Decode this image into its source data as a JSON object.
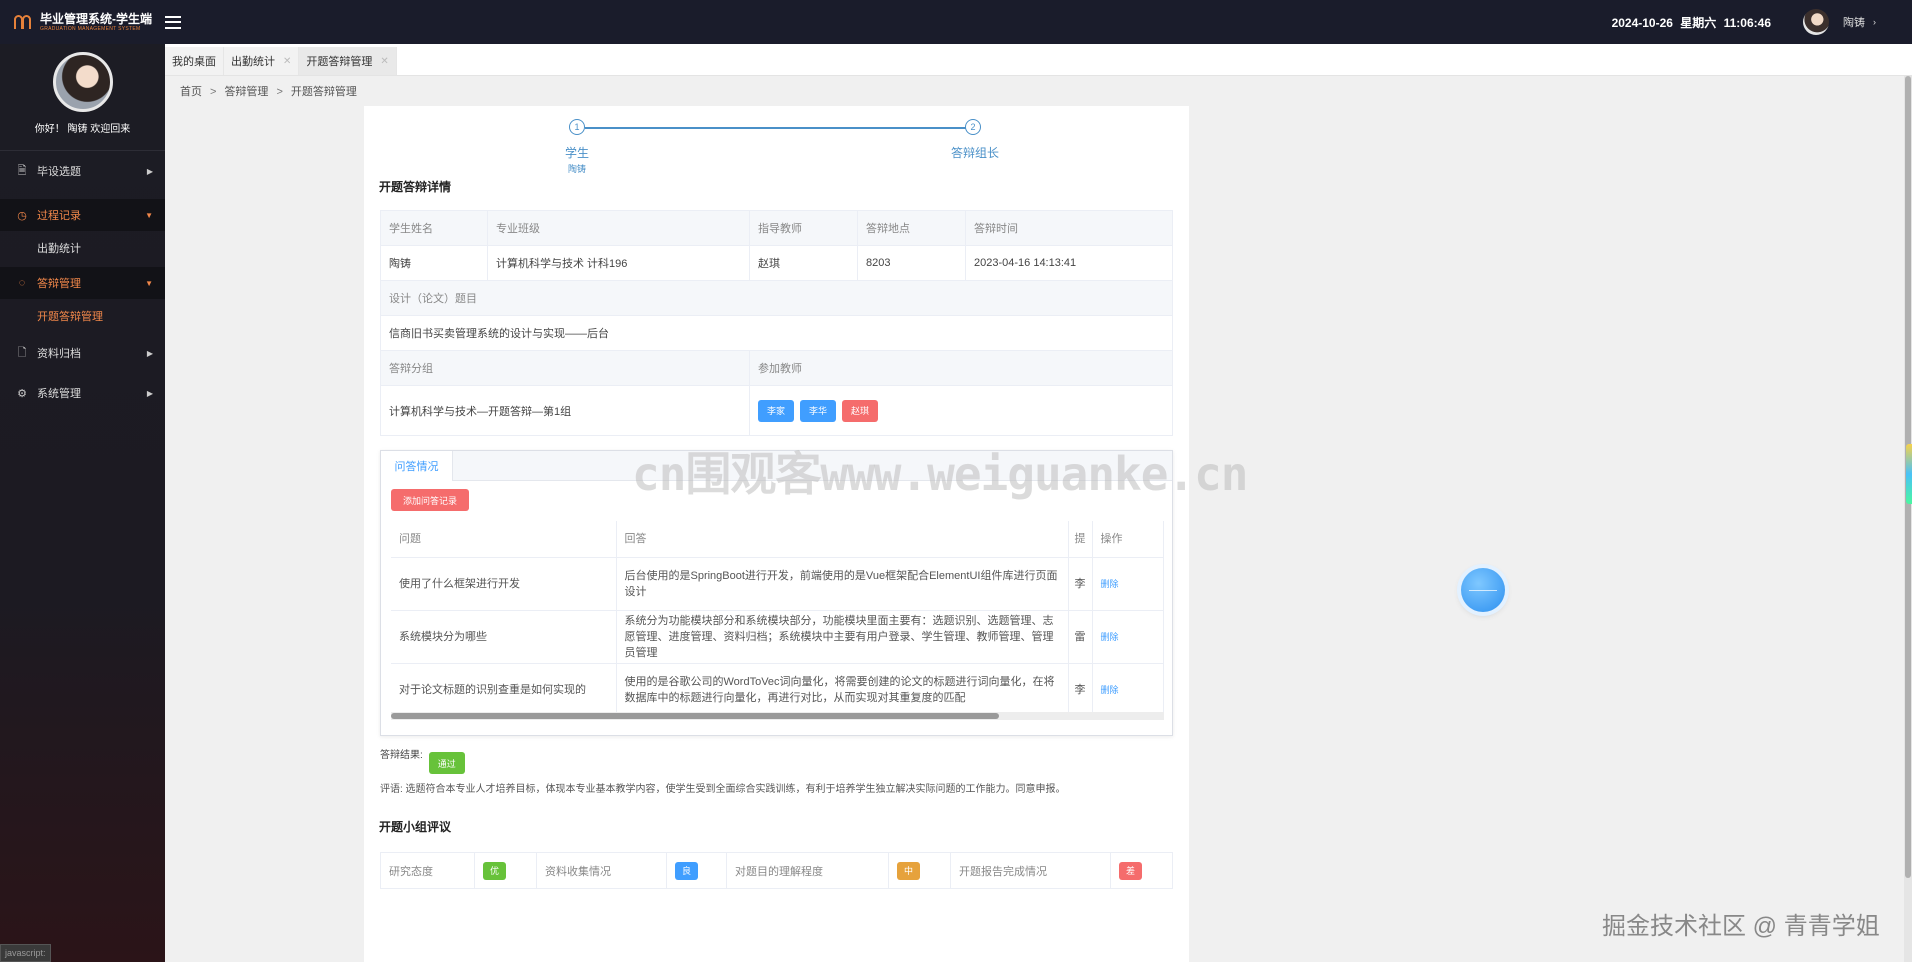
{
  "app": {
    "title": "毕业管理系统-学生端",
    "subtitle": "GRADUATION MANAGEMENT SYSTEM",
    "datetime": "2024-10-26  星期六  11:06:46",
    "user": "陶铸"
  },
  "sidebar": {
    "welcome": "你好！ 陶铸 欢迎回来",
    "items": [
      {
        "label": "毕设选题",
        "icon": "document-icon"
      },
      {
        "label": "过程记录",
        "icon": "clock-icon",
        "open": true,
        "children": [
          {
            "label": "出勤统计"
          }
        ]
      },
      {
        "label": "答辩管理",
        "icon": "chat-icon",
        "open": true,
        "children": [
          {
            "label": "开题答辩管理",
            "active": true
          }
        ]
      },
      {
        "label": "资料归档",
        "icon": "file-icon"
      },
      {
        "label": "系统管理",
        "icon": "gear-icon"
      }
    ],
    "status": "javascript:"
  },
  "tabs": [
    {
      "label": "我的桌面",
      "closable": false
    },
    {
      "label": "出勤统计",
      "closable": true
    },
    {
      "label": "开题答辩管理",
      "closable": true,
      "active": true
    }
  ],
  "breadcrumb": [
    "首页",
    "答辩管理",
    "开题答辩管理"
  ],
  "steps": [
    {
      "num": "1",
      "title": "学生",
      "sub": "陶铸"
    },
    {
      "num": "2",
      "title": "答辩组长",
      "sub": ""
    }
  ],
  "detail": {
    "title": "开题答辩详情",
    "headers": [
      "学生姓名",
      "专业班级",
      "指导教师",
      "答辩地点",
      "答辩时间"
    ],
    "values": [
      "陶铸",
      "计算机科学与技术 计科196",
      "赵琪",
      "8203",
      "2023-04-16 14:13:41"
    ],
    "topic_label": "设计（论文）题目",
    "topic_value": "信商旧书买卖管理系统的设计与实现——后台",
    "group_label": "答辩分组",
    "teachers_label": "参加教师",
    "group_value": "计算机科学与技术—开题答辩—第1组",
    "teachers": [
      {
        "name": "李家",
        "color": "#409eff"
      },
      {
        "name": "李华",
        "color": "#409eff"
      },
      {
        "name": "赵琪",
        "color": "#f56c6c"
      }
    ]
  },
  "qa": {
    "tab": "问答情况",
    "add_button": "添加问答记录",
    "headers": [
      "问题",
      "回答",
      "提",
      "操作"
    ],
    "rows": [
      {
        "q": "使用了什么框架进行开发",
        "a": "后台使用的是SpringBoot进行开发，前端使用的是Vue框架配合ElementUI组件库进行页面设计",
        "p": "李",
        "op": "删除"
      },
      {
        "q": "系统模块分为哪些",
        "a": "系统分为功能模块部分和系统模块部分，功能模块里面主要有：选题识别、选题管理、志愿管理、进度管理、资料归档；系统模块中主要有用户登录、学生管理、教师管理、管理员管理",
        "p": "雷",
        "op": "删除"
      },
      {
        "q": "对于论文标题的识别查重是如何实现的",
        "a": "使用的是谷歌公司的WordToVec词向量化，将需要创建的论文的标题进行词向量化，在将数据库中的标题进行向量化，再进行对比，从而实现对其重复度的匹配",
        "p": "李",
        "op": "删除"
      }
    ]
  },
  "result": {
    "label": "答辩结果:",
    "value": "通过",
    "comment": "评语:  选题符合本专业人才培养目标，体现本专业基本教学内容，使学生受到全面综合实践训练，有利于培养学生独立解决实际问题的工作能力。同意申报。"
  },
  "rating": {
    "title": "开题小组评议",
    "items": [
      {
        "label": "研究态度",
        "value": "优",
        "color": "#67c23a"
      },
      {
        "label": "资料收集情况",
        "value": "良",
        "color": "#409eff"
      },
      {
        "label": "对题目的理解程度",
        "value": "中",
        "color": "#e6a23c"
      },
      {
        "label": "开题报告完成情况",
        "value": "差",
        "color": "#f56c6c"
      }
    ]
  },
  "overlay": {
    "watermark": "cn围观客www.weiguanke.cn",
    "credit": "掘金技术社区 @ 青青学姐"
  }
}
